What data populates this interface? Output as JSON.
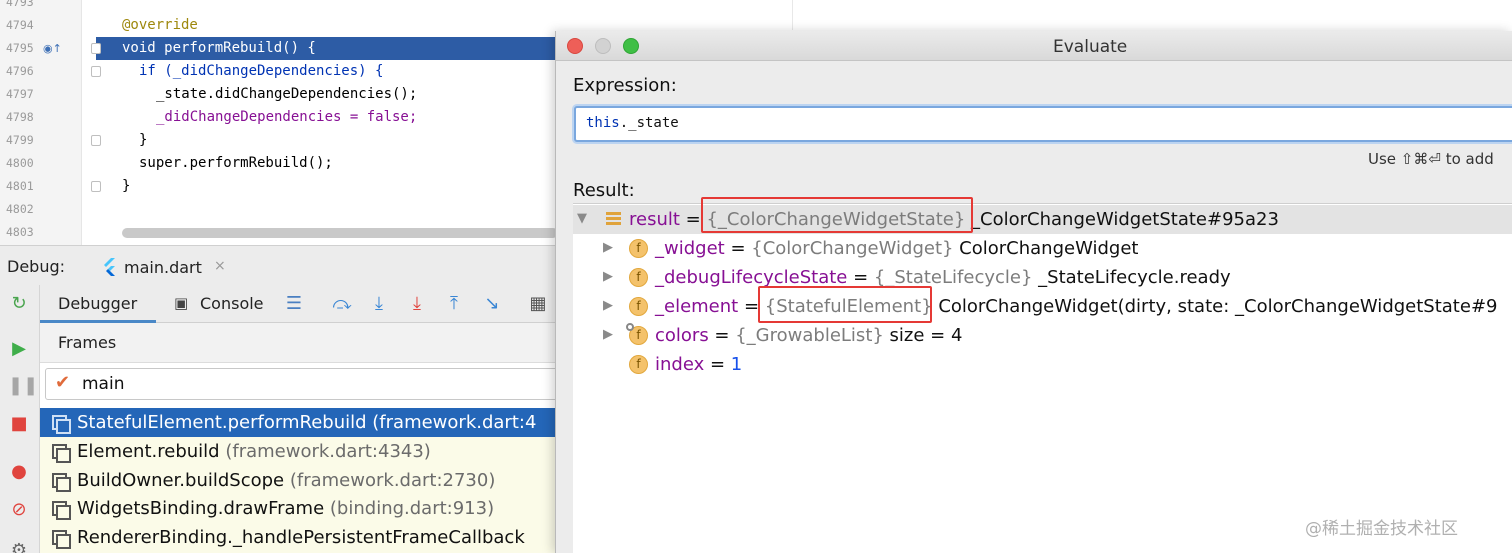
{
  "editor": {
    "lines": [
      {
        "num": "4793",
        "code": ""
      },
      {
        "num": "4794",
        "code": "@override"
      },
      {
        "num": "4795",
        "code": "void performRebuild() {"
      },
      {
        "num": "4796",
        "code": "if (_didChangeDependencies) {"
      },
      {
        "num": "4797",
        "code": "_state.didChangeDependencies();"
      },
      {
        "num": "4798",
        "code": "_didChangeDependencies = false;"
      },
      {
        "num": "4799",
        "code": "}"
      },
      {
        "num": "4800",
        "code": "super.performRebuild();"
      },
      {
        "num": "4801",
        "code": "}"
      },
      {
        "num": "4802",
        "code": ""
      },
      {
        "num": "4803",
        "code": ""
      }
    ]
  },
  "debug": {
    "label": "Debug:",
    "tab_label": "main.dart",
    "tab_close": "×",
    "tabs": {
      "debugger": "Debugger",
      "console": "Console"
    },
    "frames_title": "Frames",
    "thread": "main",
    "frames": [
      {
        "name": "StatefulElement.performRebuild",
        "loc": "(framework.dart:4",
        "selected": true
      },
      {
        "name": "Element.rebuild",
        "loc": "(framework.dart:4343)",
        "selected": false
      },
      {
        "name": "BuildOwner.buildScope",
        "loc": "(framework.dart:2730)",
        "selected": false
      },
      {
        "name": "WidgetsBinding.drawFrame",
        "loc": "(binding.dart:913)",
        "selected": false
      },
      {
        "name": "RendererBinding._handlePersistentFrameCallback",
        "loc": "",
        "selected": false
      }
    ]
  },
  "evaluate": {
    "title": "Evaluate",
    "expression_label": "Expression:",
    "expression": {
      "keyword": "this",
      "rest": "._state"
    },
    "hint": "Use ⇧⌘⏎ to add",
    "result_label": "Result:",
    "rows": [
      {
        "name": "result",
        "eq": " = ",
        "type": "{_ColorChangeWidgetState}",
        "value": " _ColorChangeWidgetState#95a23"
      },
      {
        "name": "_widget",
        "eq": " = ",
        "type": "{ColorChangeWidget}",
        "value": " ColorChangeWidget"
      },
      {
        "name": "_debugLifecycleState",
        "eq": " = ",
        "type": "{_StateLifecycle}",
        "value": " _StateLifecycle.ready"
      },
      {
        "name": "_element",
        "eq": " = ",
        "type": "{StatefulElement}",
        "value": " ColorChangeWidget(dirty, state: _ColorChangeWidgetState#9"
      },
      {
        "name": "colors",
        "eq": " = ",
        "type": "{_GrowableList}",
        "value": " size = 4"
      },
      {
        "name": "index",
        "eq": " = ",
        "type": "",
        "value": "1"
      }
    ]
  },
  "watermark": "@稀土掘金技术社区",
  "colors": {
    "selection": "#2466b8",
    "highlight_box": "#e53935",
    "field_icon": "#f4c26b"
  }
}
